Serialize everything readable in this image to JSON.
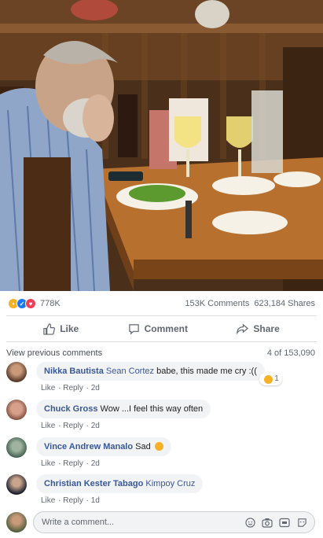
{
  "post": {
    "reactions_count": "778K",
    "comments_count": "153K Comments",
    "shares_count": "623,184 Shares"
  },
  "actions": {
    "like": "Like",
    "comment": "Comment",
    "share": "Share"
  },
  "comments_header": {
    "view_previous": "View previous comments",
    "position": "4 of 153,090"
  },
  "comments": [
    {
      "author": "Nikka Bautista",
      "tag": "Sean Cortez",
      "text": " babe, this made me cry :((",
      "like": "Like",
      "reply": "Reply",
      "time": "2d",
      "reaction_count": "1"
    },
    {
      "author": "Chuck Gross",
      "tag": "",
      "text": " Wow ...I feel this way often",
      "like": "Like",
      "reply": "Reply",
      "time": "2d"
    },
    {
      "author": "Vince Andrew Manalo",
      "tag": "",
      "text": " Sad",
      "like": "Like",
      "reply": "Reply",
      "time": "2d"
    },
    {
      "author": "Christian Kester Tabago",
      "tag": "Kimpoy Cruz",
      "text": "",
      "like": "Like",
      "reply": "Reply",
      "time": "1d"
    }
  ],
  "composer": {
    "placeholder": "Write a comment..."
  },
  "colors": {
    "link": "#385898",
    "like_blue": "#1877f2",
    "sad_yellow": "#f7b125",
    "love_red": "#f33e58"
  }
}
